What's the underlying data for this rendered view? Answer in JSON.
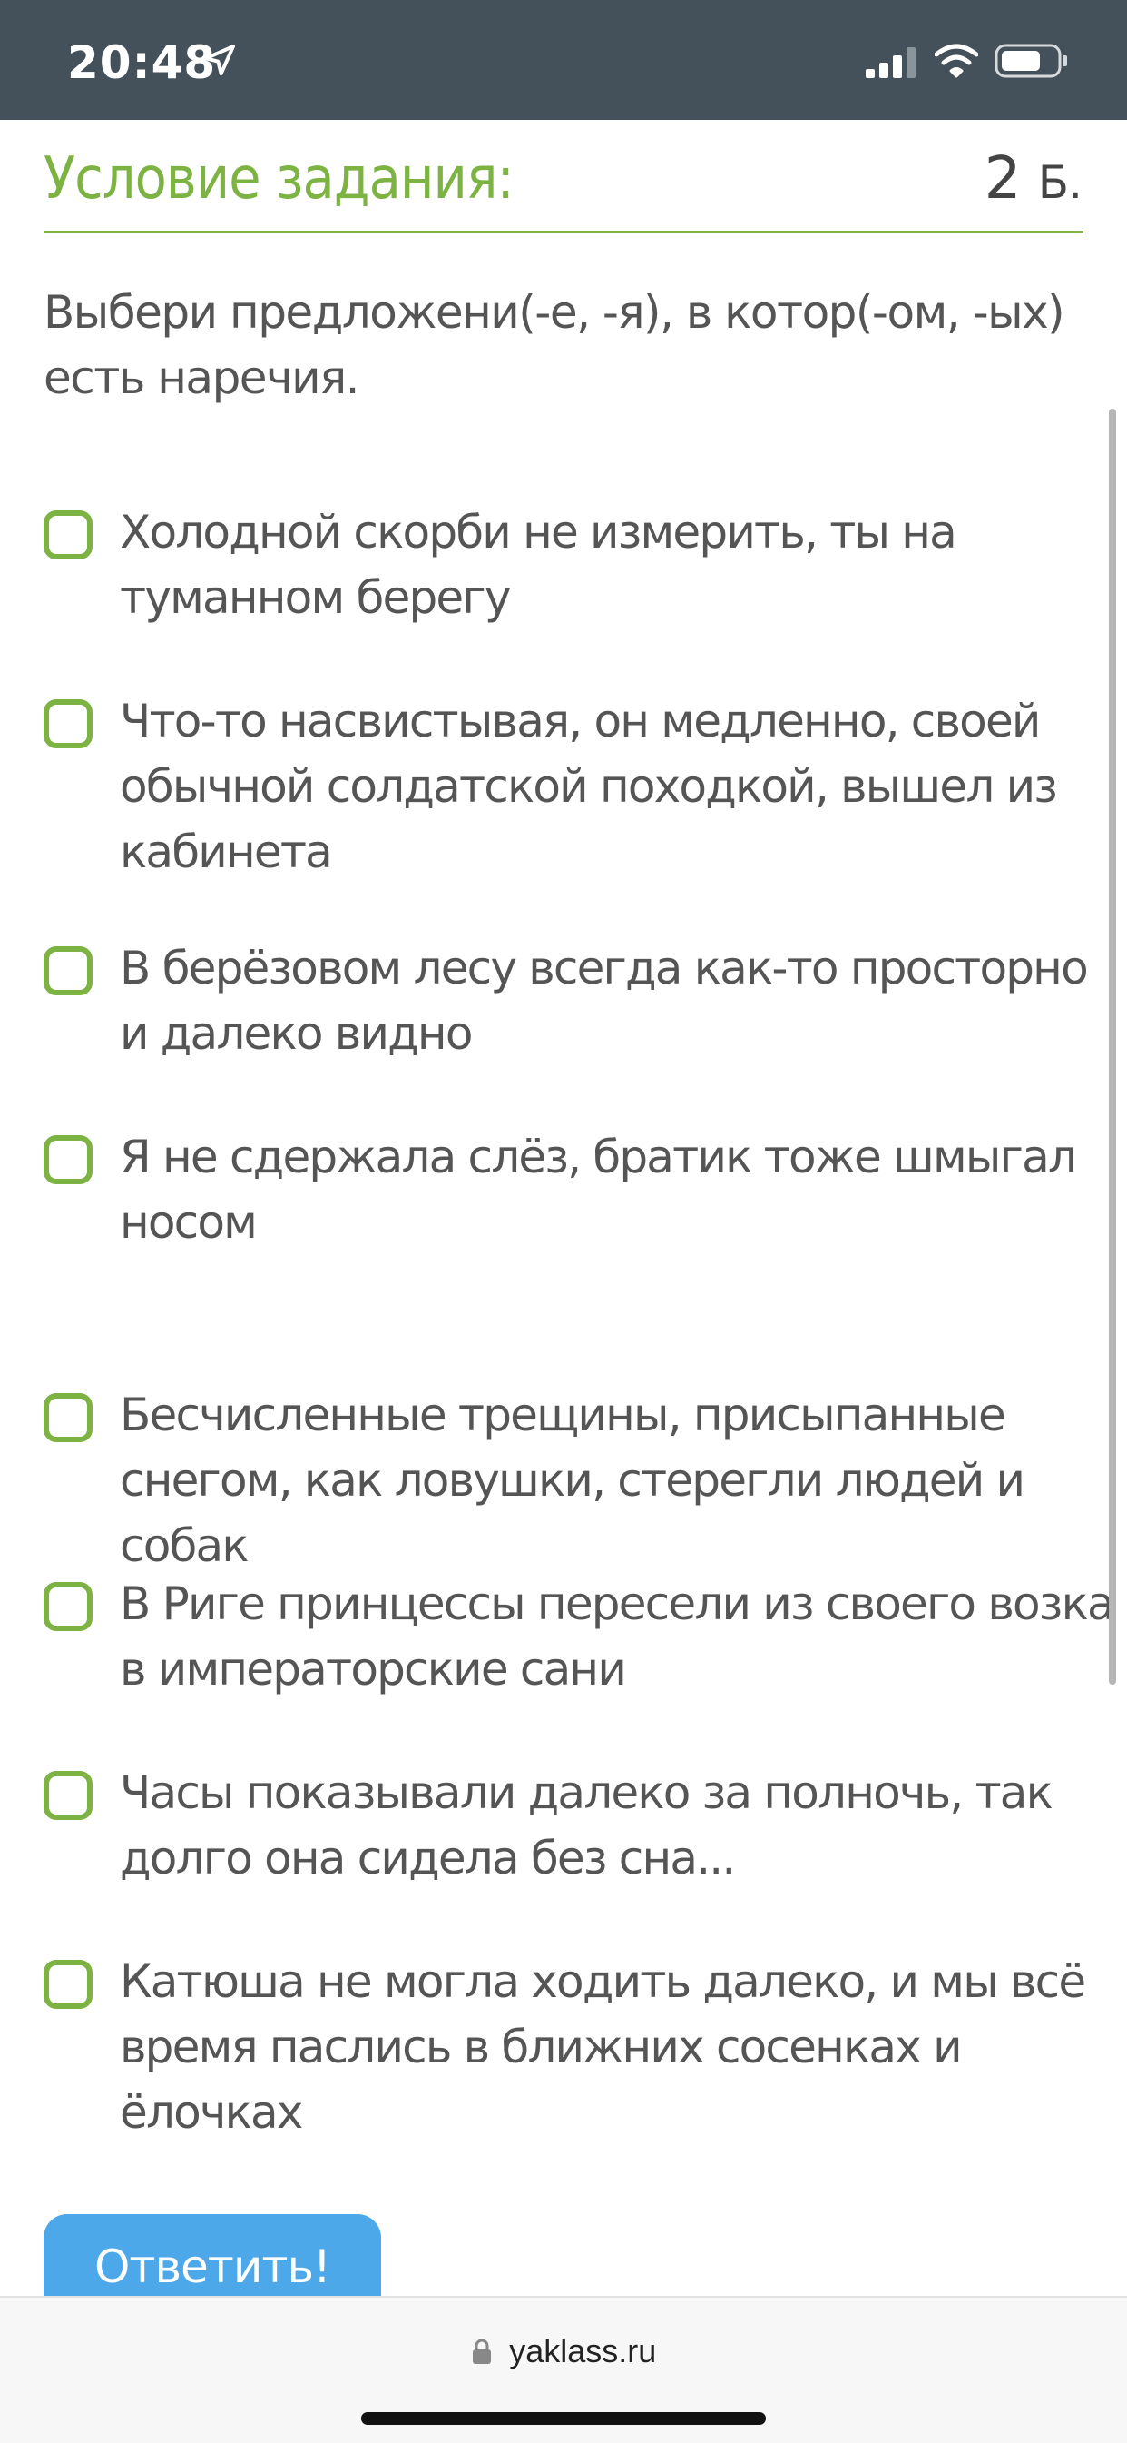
{
  "status_bar": {
    "time": "20:48"
  },
  "task": {
    "title": "Условие задания:",
    "points_value": "2",
    "points_unit": "Б.",
    "instruction": "Выбери предложени(-е, -я), в котор(-ом, -ых) есть наречия.",
    "options": [
      {
        "text": "Холодной скорби не измерить, ты на туманном берегу"
      },
      {
        "text": "Что-то насвистывая, он медленно, своей обычной солдатской походкой, вышел из кабинета"
      },
      {
        "text": "В берёзовом лесу всегда как-то просторно и далеко видно"
      },
      {
        "text": "Я не сдержала слёз, братик тоже шмыгал носом"
      },
      {
        "text": "Бесчисленные трещины, присыпанные снегом, как ловушки, стерегли людей и собак"
      },
      {
        "text": "В Риге принцессы пересели из своего возка в императорские сани"
      },
      {
        "text": "Часы показывали далеко за полночь, так долго она сидела без сна..."
      },
      {
        "text": "Катюша не могла ходить далеко, и мы всё время паслись в ближних сосенках и ёлочках"
      }
    ],
    "submit_label": "Ответить!"
  },
  "browser": {
    "url": "yaklass.ru"
  },
  "colors": {
    "accent_green": "#7cb342",
    "button_blue": "#4ca8e8",
    "status_bar_bg": "#44515a"
  },
  "icons": [
    "location-arrow-icon",
    "cellular-signal-icon",
    "wifi-icon",
    "battery-icon",
    "lock-icon"
  ]
}
